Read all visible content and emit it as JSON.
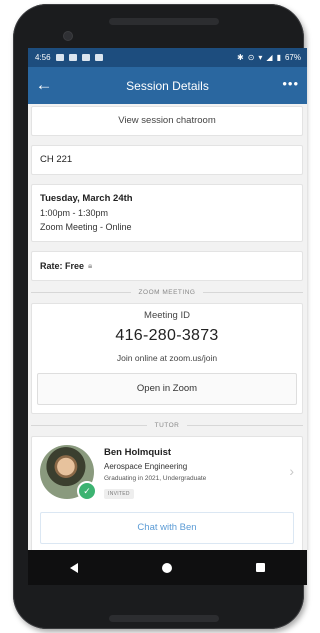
{
  "status_bar": {
    "time": "4:56",
    "battery": "67%",
    "icons": [
      "notification-icon",
      "f-icon",
      "mail-icon",
      "mail-icon",
      "bluetooth-icon",
      "alarm-icon",
      "wifi-icon",
      "signal-icon",
      "battery-icon"
    ]
  },
  "app_bar": {
    "title": "Session Details",
    "back_icon": "back-arrow-icon",
    "more_icon": "more-horiz-icon"
  },
  "session": {
    "chatroom_label": "View session chatroom",
    "course": "CH 221",
    "date": "Tuesday, March 24th",
    "time": "1:00pm - 1:30pm",
    "location": "Zoom Meeting - Online",
    "rate": "Rate: Free"
  },
  "zoom": {
    "section_label": "ZOOM MEETING",
    "meeting_id_label": "Meeting ID",
    "meeting_id": "416-280-3873",
    "join_text": "Join online at zoom.us/join",
    "open_button": "Open in Zoom"
  },
  "tutor": {
    "section_label": "TUTOR",
    "name": "Ben Holmquist",
    "major": "Aerospace Engineering",
    "graduation": "Graduating in 2021, Undergraduate",
    "status_badge": "INVITED",
    "chat_button": "Chat with Ben"
  },
  "colors": {
    "status_bar": "#1d4d7e",
    "app_bar": "#2a67a0",
    "link_blue": "#5b9bd5",
    "verified_green": "#3cb371"
  }
}
